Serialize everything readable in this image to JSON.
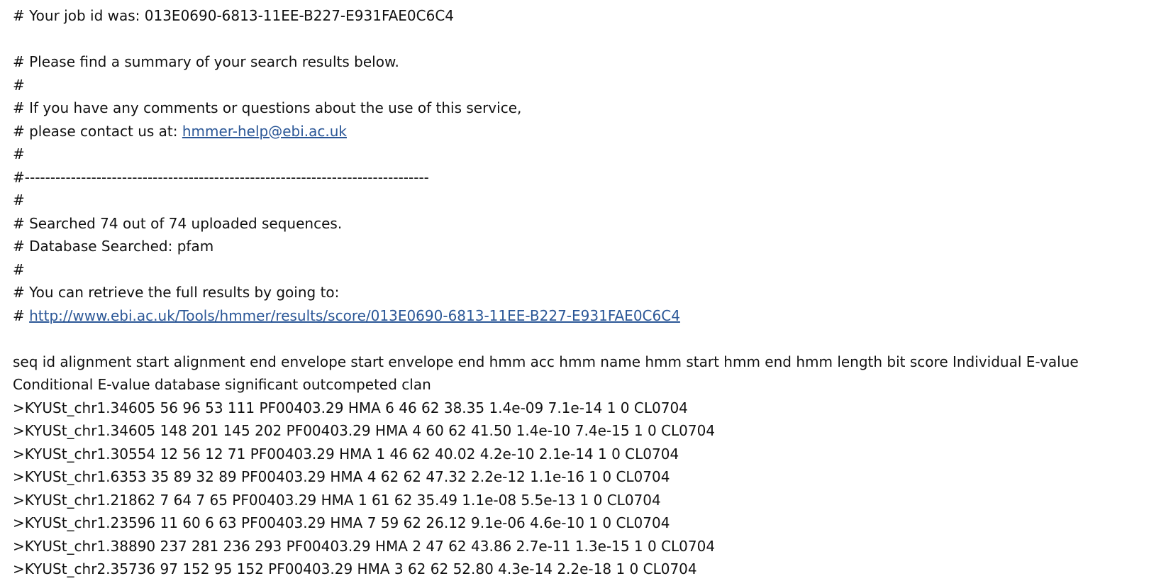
{
  "header": {
    "job_id_line": "# Your job id was: 013E0690-6813-11EE-B227-E931FAE0C6C4",
    "summary_line": "# Please find a summary of your search results below.",
    "hash": "#",
    "comments_line": "# If you have any comments or questions about the use of this service,",
    "contact_prefix": "# please contact us at: ",
    "contact_email": "hmmer-help@ebi.ac.uk",
    "separator_line": "#-------------------------------------------------------------------------------",
    "searched_line": "# Searched 74 out of 74 uploaded sequences.",
    "database_line": "# Database Searched: pfam",
    "retrieve_line": "# You can retrieve the full results by going to:",
    "results_prefix": "# ",
    "results_url": "http://www.ebi.ac.uk/Tools/hmmer/results/score/013E0690-6813-11EE-B227-E931FAE0C6C4"
  },
  "table": {
    "header_line": "seq id alignment start alignment end envelope start envelope end hmm acc hmm name hmm start hmm end hmm length bit score Individual E-value Conditional E-value database significant outcompeted clan",
    "rows": [
      ">KYUSt_chr1.34605 56 96 53 111 PF00403.29 HMA 6 46 62 38.35 1.4e-09 7.1e-14 1 0 CL0704",
      ">KYUSt_chr1.34605 148 201 145 202 PF00403.29 HMA 4 60 62 41.50 1.4e-10 7.4e-15 1 0 CL0704",
      ">KYUSt_chr1.30554 12 56 12 71 PF00403.29 HMA 1 46 62 40.02 4.2e-10 2.1e-14 1 0 CL0704",
      ">KYUSt_chr1.6353 35 89 32 89 PF00403.29 HMA 4 62 62 47.32 2.2e-12 1.1e-16 1 0 CL0704",
      ">KYUSt_chr1.21862 7 64 7 65 PF00403.29 HMA 1 61 62 35.49 1.1e-08 5.5e-13 1 0 CL0704",
      ">KYUSt_chr1.23596 11 60 6 63 PF00403.29 HMA 7 59 62 26.12 9.1e-06 4.6e-10 1 0 CL0704",
      ">KYUSt_chr1.38890 237 281 236 293 PF00403.29 HMA 2 47 62 43.86 2.7e-11 1.3e-15 1 0 CL0704",
      ">KYUSt_chr2.35736 97 152 95 152 PF00403.29 HMA 3 62 62 52.80 4.3e-14 2.2e-18 1 0 CL0704"
    ]
  }
}
